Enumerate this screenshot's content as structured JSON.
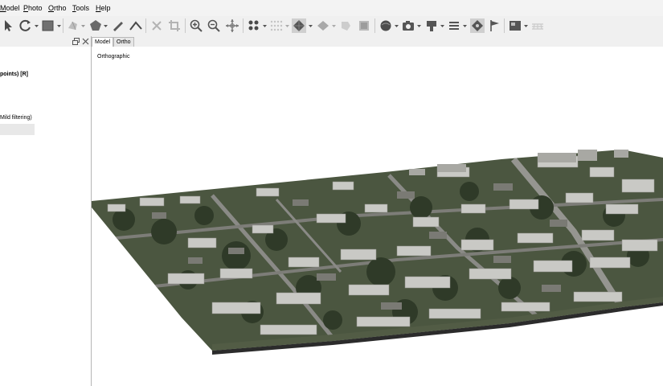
{
  "menu": {
    "items": [
      {
        "label": "Model"
      },
      {
        "label": "Photo"
      },
      {
        "label": "Ortho"
      },
      {
        "label": "Tools"
      },
      {
        "label": "Help"
      }
    ]
  },
  "toolbar": {
    "tools": [
      "navigation-arrow-icon",
      "rotate-object-icon",
      "rectangle-selection-icon",
      "free-form-selection-icon",
      "polygon-shape-icon",
      "ruler-icon",
      "polyline-icon",
      "delete-selection-icon",
      "crop-icon",
      "zoom-in-icon",
      "zoom-out-icon",
      "move-object-icon",
      "show-points-icon",
      "show-dense-cloud-icon",
      "show-model-icon",
      "show-tiled-model-icon",
      "texture-icon",
      "show-dem-icon",
      "show-cameras-icon",
      "capture-view-icon",
      "shapes-icon",
      "layers-icon",
      "markers-icon",
      "flags-icon",
      "ortho-view-icon",
      "grid-icon"
    ]
  },
  "left_pane": {
    "info_line": "points) [R]",
    "filter_line": "Mild filtering)"
  },
  "tabs": [
    {
      "label": "Model",
      "active": true
    },
    {
      "label": "Ortho",
      "active": false
    }
  ],
  "viewport": {
    "projection_label": "Orthographic"
  },
  "colors": {
    "window_bg": "#f0f0f0",
    "viewport_bg": "#ffffff",
    "roof_grey": "#c8c8c8",
    "vegetation": "#3d4a34",
    "toolbar_accent": "#6b6b6b"
  }
}
